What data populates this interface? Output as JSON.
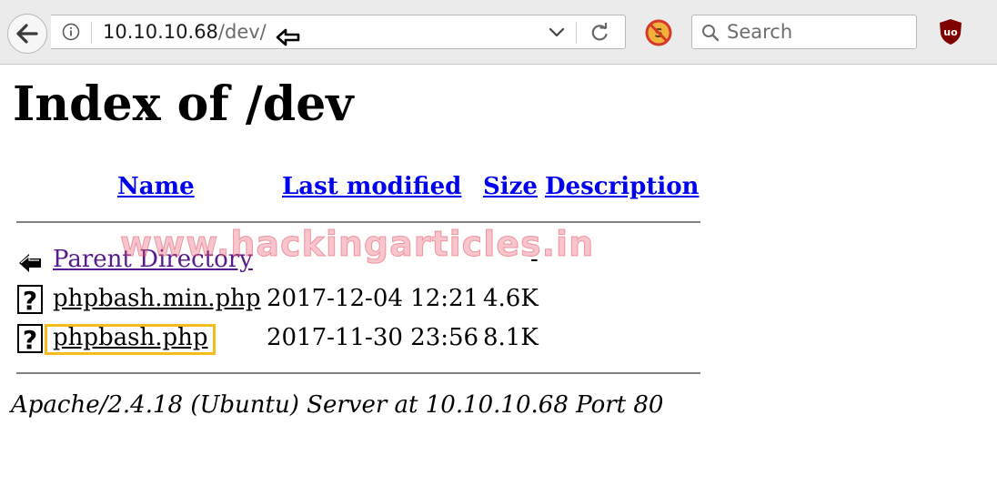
{
  "browser": {
    "url_host": "10.10.10.68",
    "url_path": "/dev/",
    "search_placeholder": "Search",
    "icons": {
      "back": "back-arrow-icon",
      "info": "info-icon",
      "dropdown": "chevron-down-icon",
      "reload": "reload-icon",
      "noscript": "noscript-icon",
      "search": "search-icon",
      "ublock": "ublock-origin-icon",
      "cursor": "mouse-cursor-icon"
    }
  },
  "page": {
    "title": "Index of /dev",
    "columns": {
      "name": "Name",
      "last_modified": "Last modified",
      "size": "Size",
      "description": "Description"
    },
    "rows": [
      {
        "name": "Parent Directory",
        "modified": "",
        "size": "-",
        "icon": "back-folder-icon"
      },
      {
        "name": "phpbash.min.php",
        "modified": "2017-12-04 12:21",
        "size": "4.6K",
        "icon": "unknown-file-icon"
      },
      {
        "name": "phpbash.php",
        "modified": "2017-11-30 23:56",
        "size": "8.1K",
        "icon": "unknown-file-icon"
      }
    ],
    "footer": "Apache/2.4.18 (Ubuntu) Server at 10.10.10.68 Port 80",
    "watermark": "www.hackingarticles.in"
  },
  "colors": {
    "link": "#0000ee",
    "visited_link": "#551a8b",
    "highlight": "#f5bc1c"
  }
}
